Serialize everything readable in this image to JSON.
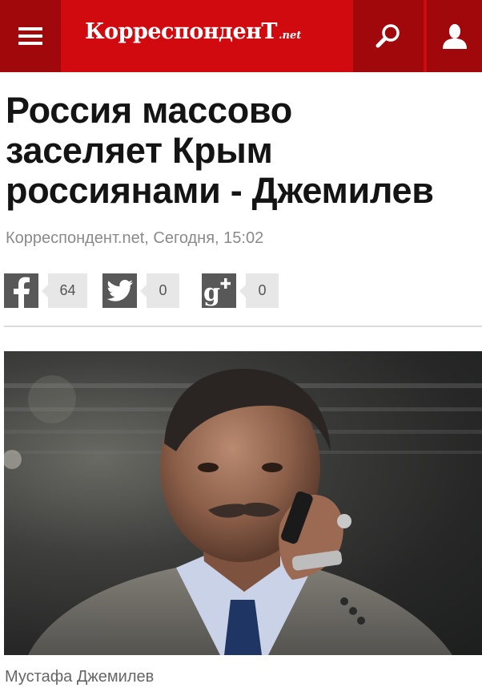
{
  "header": {
    "logo_main": "КорреспонденТ",
    "logo_suffix": ".net",
    "menu_icon": "hamburger-menu-icon",
    "search_icon": "search-icon",
    "user_icon": "user-icon",
    "brand_color": "#d10a10"
  },
  "article": {
    "title_lines": [
      "Россия массово",
      "заселяет Крым",
      "россиянами - Джемилев"
    ],
    "meta": "Корреспондент.net, Сегодня, 15:02",
    "share": {
      "facebook": {
        "icon": "facebook-icon",
        "count": "64"
      },
      "twitter": {
        "icon": "twitter-icon",
        "count": "0"
      },
      "google_plus": {
        "icon": "google-plus-icon",
        "count": "0"
      }
    },
    "photo_caption": "Мустафа Джемилев"
  }
}
